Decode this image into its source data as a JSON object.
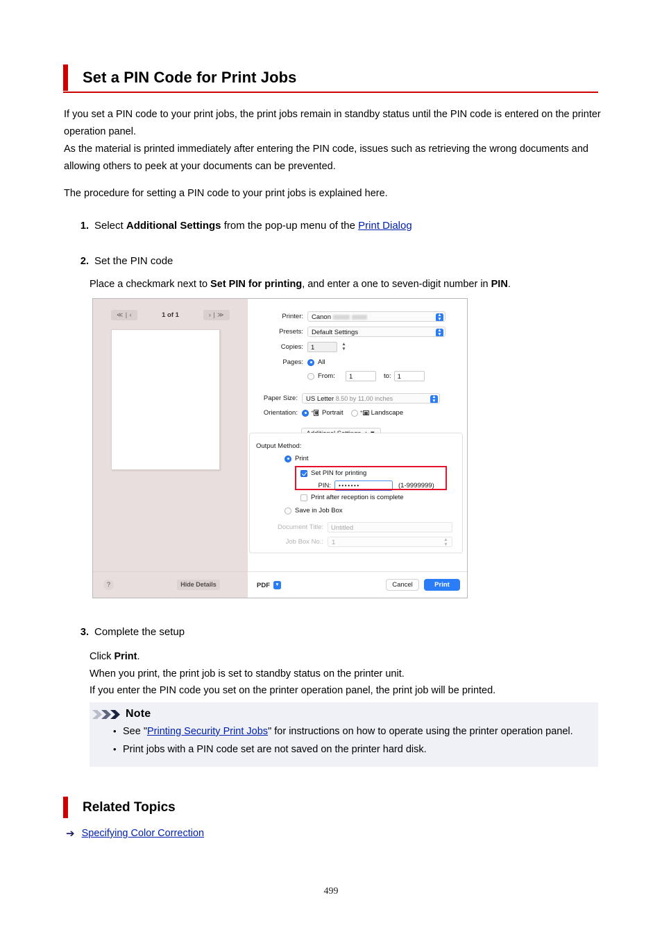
{
  "page": {
    "number": "499"
  },
  "heading": {
    "title": "Set a PIN Code for Print Jobs",
    "accent_color": "#cc0000"
  },
  "intro": {
    "line1": "If you set a PIN code to your print jobs, the print jobs remain in standby status until the PIN code is entered on the printer operation panel.",
    "line2": "As the material is printed immediately after entering the PIN code, issues such as retrieving the wrong documents and allowing others to peek at your documents can be prevented.",
    "procedure": "The procedure for setting a PIN code to your print jobs is explained here."
  },
  "steps": {
    "one": {
      "num": "1.",
      "text_before": "Select ",
      "bold": "Additional Settings",
      "text_mid": " from the pop-up menu of the ",
      "link": "Print Dialog"
    },
    "two": {
      "num": "2.",
      "title": "Set the PIN code",
      "desc_before": "Place a checkmark next to ",
      "desc_bold1": "Set PIN for printing",
      "desc_mid": ", and enter a one to seven-digit number in ",
      "desc_bold2": "PIN",
      "desc_end": "."
    },
    "three": {
      "num": "3.",
      "title": "Complete the setup",
      "line1_before": "Click ",
      "line1_bold": "Print",
      "line1_end": ".",
      "line2": "When you print, the print job is set to standby status on the printer unit.",
      "line3": "If you enter the PIN code you set on the printer operation panel, the print job will be printed."
    }
  },
  "note": {
    "title": "Note",
    "items": [
      {
        "before": "See \"",
        "link": "Printing Security Print Jobs",
        "after": "\" for instructions on how to operate using the printer operation panel."
      },
      {
        "before": "Print jobs with a PIN code set are not saved on the printer hard disk.",
        "link": "",
        "after": ""
      }
    ],
    "background_color": "#f0f1f7"
  },
  "related_topics": {
    "title": "Related Topics",
    "links": [
      "Specifying Color Correction"
    ]
  },
  "print_dialog": {
    "preview": {
      "page_count": "1 of 1",
      "prev_button": "≪ | ‹",
      "next_button": "› | ≫"
    },
    "fields": {
      "printer_label": "Printer:",
      "printer_value": "Canon",
      "presets_label": "Presets:",
      "presets_value": "Default Settings",
      "copies_label": "Copies:",
      "copies_value": "1",
      "pages_label": "Pages:",
      "pages_all": "All",
      "pages_from": "From:",
      "pages_from_value": "1",
      "pages_to": "to:",
      "pages_to_value": "1",
      "paper_size_label": "Paper Size:",
      "paper_size_value": "US Letter",
      "paper_size_dim": "8.50 by 11.00 inches",
      "orientation_label": "Orientation:",
      "orientation_portrait": "Portrait",
      "orientation_landscape": "Landscape"
    },
    "additional_settings": {
      "popup_value": "Additional Settings",
      "output_method_label": "Output Method:",
      "print_option": "Print",
      "set_pin_option": "Set PIN for printing",
      "pin_label": "PIN:",
      "pin_value": "•••••••",
      "pin_range": "(1-9999999)",
      "print_after_reception": "Print after reception is complete",
      "save_in_job_box": "Save in Job Box",
      "document_title_label": "Document Title:",
      "document_title_value": "Untitled",
      "job_box_no_label": "Job Box No.:",
      "job_box_no_value": "1",
      "highlight_color": "#e8112d"
    },
    "footer": {
      "help": "?",
      "hide_details": "Hide Details",
      "pdf": "PDF",
      "cancel": "Cancel",
      "print": "Print"
    }
  }
}
